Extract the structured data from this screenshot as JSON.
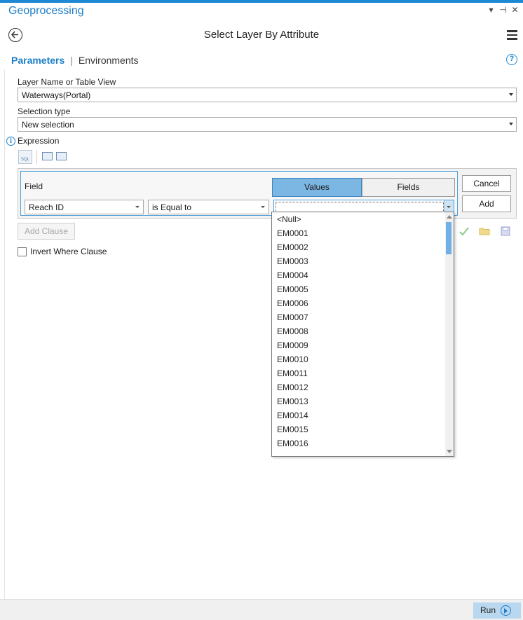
{
  "pane": {
    "title": "Geoprocessing",
    "controls": [
      "▾",
      "⊣",
      "✕"
    ]
  },
  "tool": {
    "title": "Select Layer By Attribute"
  },
  "tabs": {
    "parameters": "Parameters",
    "environments": "Environments"
  },
  "params": {
    "layer_label": "Layer Name or Table View",
    "layer_value": "Waterways(Portal)",
    "selection_label": "Selection type",
    "selection_value": "New selection",
    "expression_label": "Expression",
    "sql_icon_text": "SQL"
  },
  "clause": {
    "field_label": "Field",
    "values_tab": "Values",
    "fields_tab": "Fields",
    "field_value": "Reach ID",
    "operator_value": "is Equal to",
    "value_value": "",
    "cancel_label": "Cancel",
    "add_label": "Add"
  },
  "add_clause_label": "Add Clause",
  "invert_label": "Invert Where Clause",
  "dropdown": {
    "items": [
      "<Null>",
      "EM0001",
      "EM0002",
      "EM0003",
      "EM0004",
      "EM0005",
      "EM0006",
      "EM0007",
      "EM0008",
      "EM0009",
      "EM0010",
      "EM0011",
      "EM0012",
      "EM0013",
      "EM0014",
      "EM0015",
      "EM0016"
    ]
  },
  "footer": {
    "run_label": "Run"
  },
  "colors": {
    "accent": "#1e7fc8",
    "values_tab_bg": "#7cb6e3",
    "run_bg": "#b9d7ee"
  }
}
